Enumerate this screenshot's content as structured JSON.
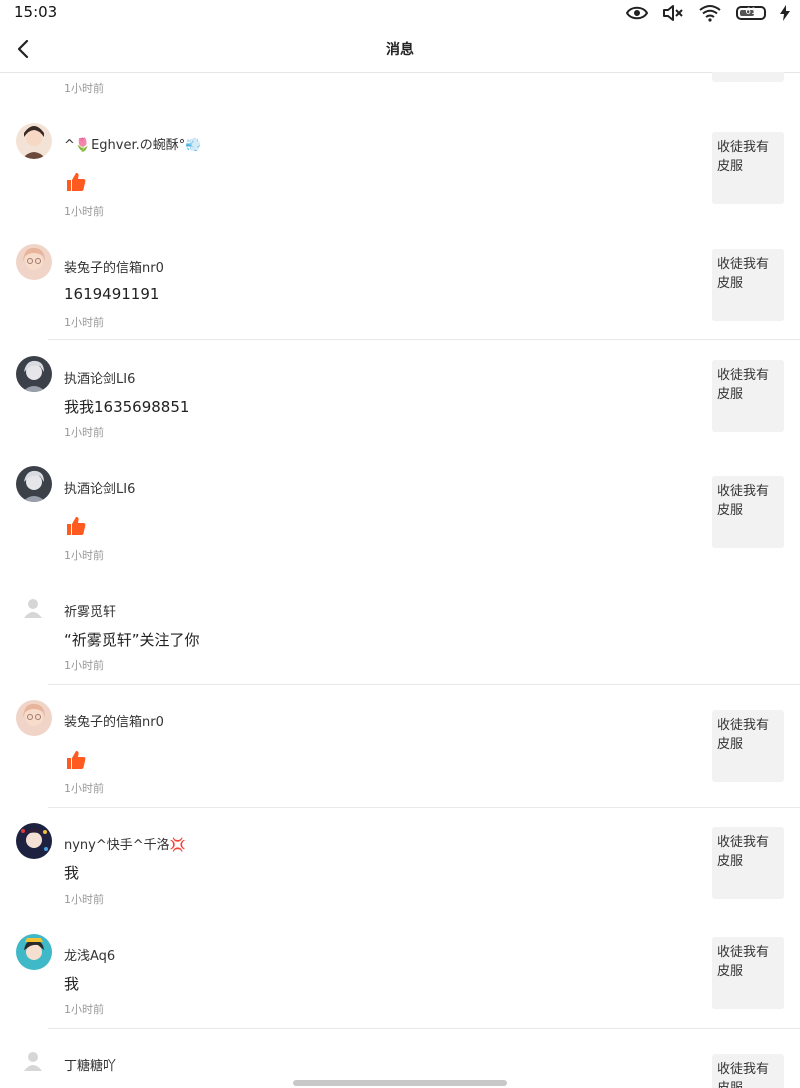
{
  "status_bar": {
    "time": "15:03",
    "battery": "61"
  },
  "header": {
    "title": "消息"
  },
  "first_time": "1小时前",
  "items": [
    {
      "user": "^🌷Eghver.の蜿酥°💨",
      "content": "",
      "like": true,
      "time": "1小时前",
      "post": "收徒我有皮服"
    },
    {
      "user": "装兔子的信箱nr0",
      "content": "1619491191",
      "like": false,
      "time": "1小时前",
      "post": "收徒我有皮服"
    },
    {
      "user": "执酒论剑LI6",
      "content": "我我1635698851",
      "like": false,
      "time": "1小时前",
      "post": "收徒我有皮服"
    },
    {
      "user": "执酒论剑LI6",
      "content": "",
      "like": true,
      "time": "1小时前",
      "post": "收徒我有皮服"
    },
    {
      "user": "祈雾觅轩",
      "content": "“祈雾觅轩”关注了你",
      "like": false,
      "time": "1小时前",
      "post": ""
    },
    {
      "user": "装兔子的信箱nr0",
      "content": "",
      "like": true,
      "time": "1小时前",
      "post": "收徒我有皮服"
    },
    {
      "user": "nyny^快手^千洛💢",
      "content": "我",
      "like": false,
      "time": "1小时前",
      "post": "收徒我有皮服"
    },
    {
      "user": "龙浅Aq6",
      "content": "我",
      "like": false,
      "time": "1小时前",
      "post": "收徒我有皮服"
    },
    {
      "user": "丁糖糖吖",
      "content": "",
      "like": false,
      "time": "",
      "post": "收徒我有皮服"
    }
  ],
  "colors": {
    "like": "#ff5a1f",
    "divider": "#e8e8e8",
    "thumb_bg": "#f2f2f2"
  },
  "icons": {
    "back": "chevron-left-icon",
    "like": "thumbs-up-icon",
    "default_avatar": "person-icon"
  }
}
